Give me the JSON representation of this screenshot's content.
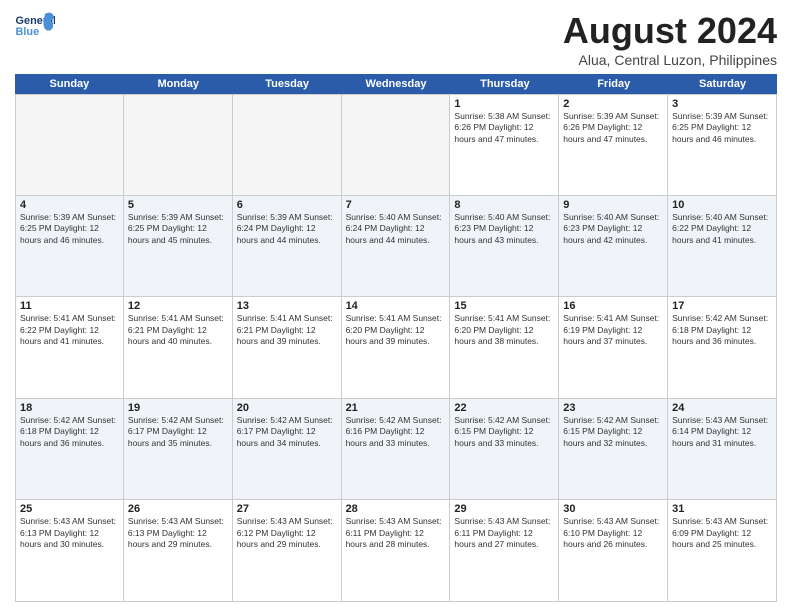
{
  "header": {
    "logo_general": "General",
    "logo_blue": "Blue",
    "month_year": "August 2024",
    "location": "Alua, Central Luzon, Philippines"
  },
  "weekdays": [
    "Sunday",
    "Monday",
    "Tuesday",
    "Wednesday",
    "Thursday",
    "Friday",
    "Saturday"
  ],
  "rows": [
    [
      {
        "day": "",
        "content": ""
      },
      {
        "day": "",
        "content": ""
      },
      {
        "day": "",
        "content": ""
      },
      {
        "day": "",
        "content": ""
      },
      {
        "day": "1",
        "content": "Sunrise: 5:38 AM\nSunset: 6:26 PM\nDaylight: 12 hours\nand 47 minutes."
      },
      {
        "day": "2",
        "content": "Sunrise: 5:39 AM\nSunset: 6:26 PM\nDaylight: 12 hours\nand 47 minutes."
      },
      {
        "day": "3",
        "content": "Sunrise: 5:39 AM\nSunset: 6:25 PM\nDaylight: 12 hours\nand 46 minutes."
      }
    ],
    [
      {
        "day": "4",
        "content": "Sunrise: 5:39 AM\nSunset: 6:25 PM\nDaylight: 12 hours\nand 46 minutes."
      },
      {
        "day": "5",
        "content": "Sunrise: 5:39 AM\nSunset: 6:25 PM\nDaylight: 12 hours\nand 45 minutes."
      },
      {
        "day": "6",
        "content": "Sunrise: 5:39 AM\nSunset: 6:24 PM\nDaylight: 12 hours\nand 44 minutes."
      },
      {
        "day": "7",
        "content": "Sunrise: 5:40 AM\nSunset: 6:24 PM\nDaylight: 12 hours\nand 44 minutes."
      },
      {
        "day": "8",
        "content": "Sunrise: 5:40 AM\nSunset: 6:23 PM\nDaylight: 12 hours\nand 43 minutes."
      },
      {
        "day": "9",
        "content": "Sunrise: 5:40 AM\nSunset: 6:23 PM\nDaylight: 12 hours\nand 42 minutes."
      },
      {
        "day": "10",
        "content": "Sunrise: 5:40 AM\nSunset: 6:22 PM\nDaylight: 12 hours\nand 41 minutes."
      }
    ],
    [
      {
        "day": "11",
        "content": "Sunrise: 5:41 AM\nSunset: 6:22 PM\nDaylight: 12 hours\nand 41 minutes."
      },
      {
        "day": "12",
        "content": "Sunrise: 5:41 AM\nSunset: 6:21 PM\nDaylight: 12 hours\nand 40 minutes."
      },
      {
        "day": "13",
        "content": "Sunrise: 5:41 AM\nSunset: 6:21 PM\nDaylight: 12 hours\nand 39 minutes."
      },
      {
        "day": "14",
        "content": "Sunrise: 5:41 AM\nSunset: 6:20 PM\nDaylight: 12 hours\nand 39 minutes."
      },
      {
        "day": "15",
        "content": "Sunrise: 5:41 AM\nSunset: 6:20 PM\nDaylight: 12 hours\nand 38 minutes."
      },
      {
        "day": "16",
        "content": "Sunrise: 5:41 AM\nSunset: 6:19 PM\nDaylight: 12 hours\nand 37 minutes."
      },
      {
        "day": "17",
        "content": "Sunrise: 5:42 AM\nSunset: 6:18 PM\nDaylight: 12 hours\nand 36 minutes."
      }
    ],
    [
      {
        "day": "18",
        "content": "Sunrise: 5:42 AM\nSunset: 6:18 PM\nDaylight: 12 hours\nand 36 minutes."
      },
      {
        "day": "19",
        "content": "Sunrise: 5:42 AM\nSunset: 6:17 PM\nDaylight: 12 hours\nand 35 minutes."
      },
      {
        "day": "20",
        "content": "Sunrise: 5:42 AM\nSunset: 6:17 PM\nDaylight: 12 hours\nand 34 minutes."
      },
      {
        "day": "21",
        "content": "Sunrise: 5:42 AM\nSunset: 6:16 PM\nDaylight: 12 hours\nand 33 minutes."
      },
      {
        "day": "22",
        "content": "Sunrise: 5:42 AM\nSunset: 6:15 PM\nDaylight: 12 hours\nand 33 minutes."
      },
      {
        "day": "23",
        "content": "Sunrise: 5:42 AM\nSunset: 6:15 PM\nDaylight: 12 hours\nand 32 minutes."
      },
      {
        "day": "24",
        "content": "Sunrise: 5:43 AM\nSunset: 6:14 PM\nDaylight: 12 hours\nand 31 minutes."
      }
    ],
    [
      {
        "day": "25",
        "content": "Sunrise: 5:43 AM\nSunset: 6:13 PM\nDaylight: 12 hours\nand 30 minutes."
      },
      {
        "day": "26",
        "content": "Sunrise: 5:43 AM\nSunset: 6:13 PM\nDaylight: 12 hours\nand 29 minutes."
      },
      {
        "day": "27",
        "content": "Sunrise: 5:43 AM\nSunset: 6:12 PM\nDaylight: 12 hours\nand 29 minutes."
      },
      {
        "day": "28",
        "content": "Sunrise: 5:43 AM\nSunset: 6:11 PM\nDaylight: 12 hours\nand 28 minutes."
      },
      {
        "day": "29",
        "content": "Sunrise: 5:43 AM\nSunset: 6:11 PM\nDaylight: 12 hours\nand 27 minutes."
      },
      {
        "day": "30",
        "content": "Sunrise: 5:43 AM\nSunset: 6:10 PM\nDaylight: 12 hours\nand 26 minutes."
      },
      {
        "day": "31",
        "content": "Sunrise: 5:43 AM\nSunset: 6:09 PM\nDaylight: 12 hours\nand 25 minutes."
      }
    ]
  ]
}
